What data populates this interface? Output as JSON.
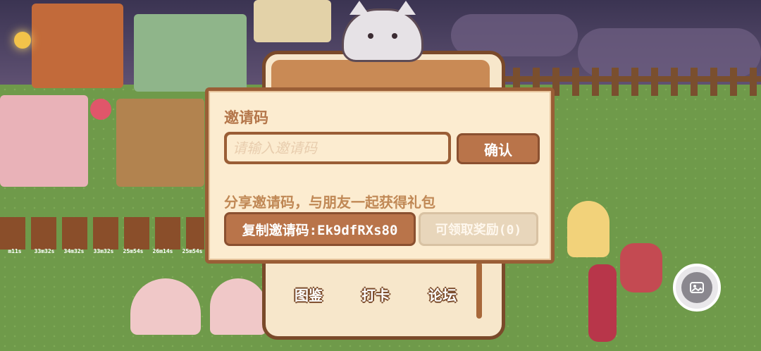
{
  "dialog": {
    "title": "邀请码",
    "input_placeholder": "请输入邀请码",
    "input_value": "",
    "confirm_label": "确认",
    "share_text": "分享邀请码，与朋友一起获得礼包",
    "copy_label": "复制邀请码:Ek9dfRXs80",
    "claim_label": "可领取奖励(0)"
  },
  "board": {
    "bottom_labels": [
      "图鉴",
      "打卡",
      "论坛"
    ]
  },
  "plant_timers": [
    "m11s",
    "33m32s",
    "34m32s",
    "33m32s",
    "25m54s",
    "26m14s",
    "25m54s"
  ],
  "icons": {
    "fab": "gallery-icon"
  },
  "colors": {
    "dialog_bg": "#fcecd0",
    "dialog_border": "#9a5e36",
    "button_brown": "#b9744a",
    "button_disabled": "#e8d6bb",
    "grass": "#6f9a4a"
  }
}
